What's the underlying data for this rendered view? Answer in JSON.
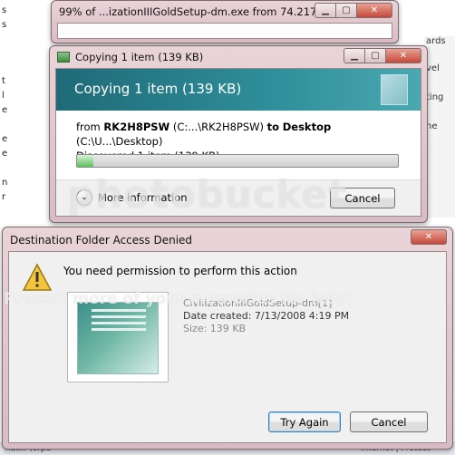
{
  "background": {
    "left_fragments": [
      "s",
      "s",
      "t",
      "l",
      "e",
      "e",
      "e",
      "n",
      "r"
    ],
    "right_fragments": [
      "ards",
      "vel",
      "ting",
      "ne"
    ],
    "bottom_fragments": [
      "hat... (orpe",
      "Internet | Protect"
    ]
  },
  "download_window": {
    "title": "99% of ...izationIIIGoldSetup-dm.exe from 74.217...."
  },
  "copy_window": {
    "title": "Copying 1 item (139 KB)",
    "banner_title": "Copying 1 item (139 KB)",
    "from_label": "from",
    "source_name": "RK2H8PSW",
    "source_path": "(C:...\\RK2H8PSW)",
    "to_label": "to",
    "dest_name": "Desktop",
    "dest_path": "(C:\\U...\\Desktop)",
    "status": "Discovered 1 item (139 KB)...",
    "progress": 0.05,
    "more_info_label": "More information",
    "cancel_label": "Cancel"
  },
  "denied_window": {
    "title": "Destination Folder Access Denied",
    "message": "You need permission to perform this action",
    "file_name": "CivilizationIIIGoldSetup-dm[1]",
    "date_label": "Date created:",
    "date_value": "7/13/2008 4:19 PM",
    "size_label": "Size:",
    "size_value": "139 KB",
    "try_again_label": "Try Again",
    "cancel_label": "Cancel"
  },
  "watermark": {
    "main": "photobucket",
    "sub": "Protect more of your memories for less!"
  },
  "colors": {
    "banner": "#1f6a78",
    "frame": "#d9bcc3",
    "close_button": "#c6483a"
  },
  "icons": [
    "minimize-icon",
    "maximize-icon",
    "close-icon",
    "copy-icon",
    "chevron-down-icon",
    "warning-icon",
    "file-thumbnail"
  ]
}
